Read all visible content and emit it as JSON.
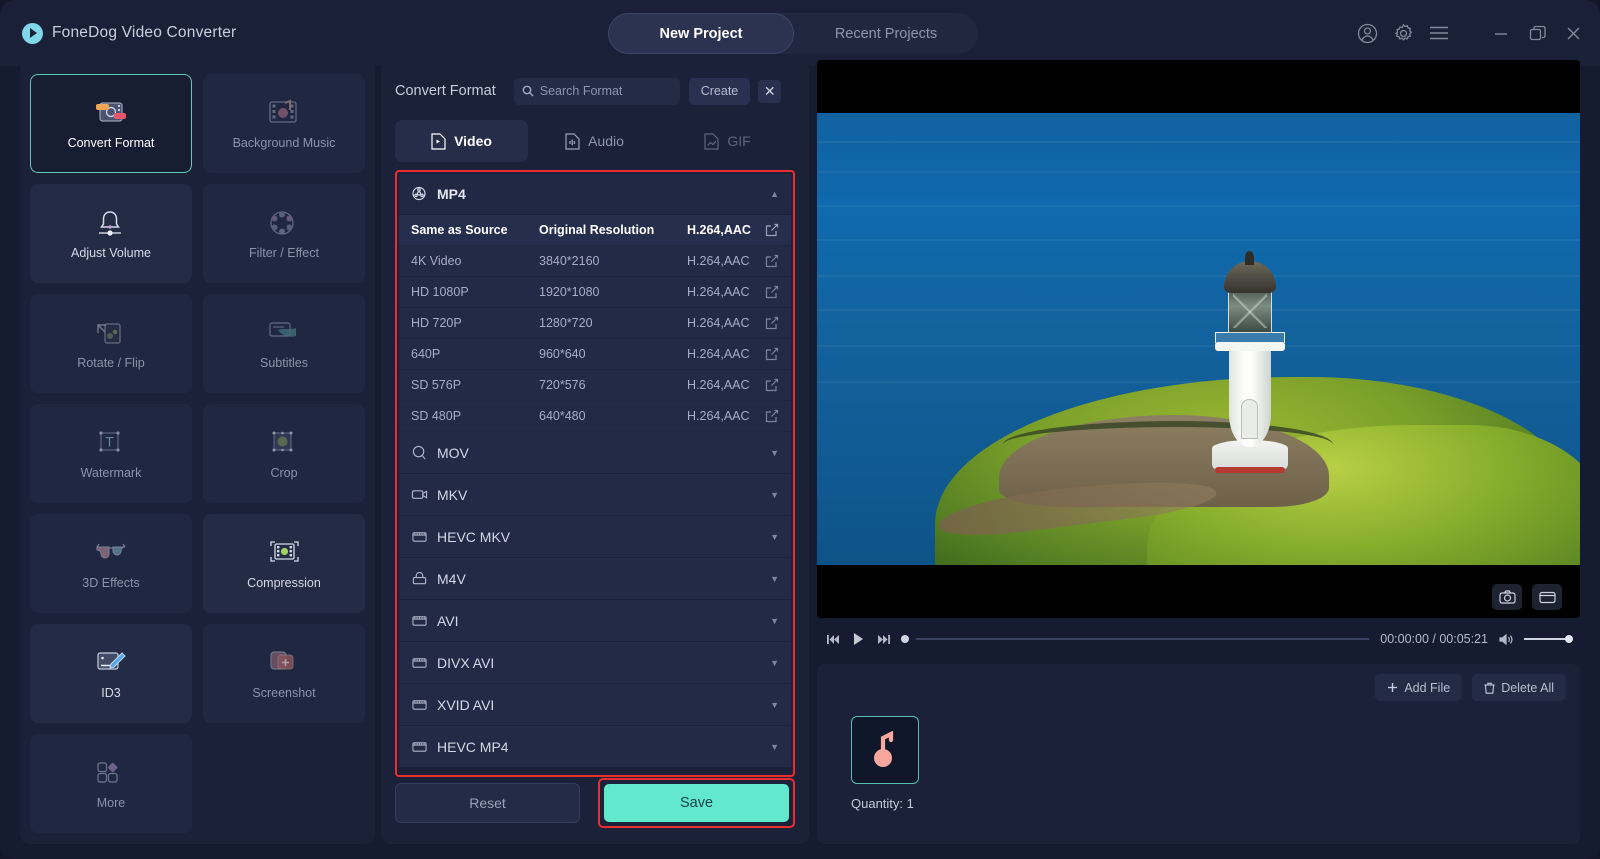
{
  "app": {
    "title": "FoneDog Video Converter",
    "logo_icon": "play-circle-icon"
  },
  "header": {
    "tabs": [
      {
        "label": "New Project",
        "active": true
      },
      {
        "label": "Recent Projects",
        "active": false
      }
    ],
    "window_icons": [
      "account-icon",
      "gear-icon",
      "menu-icon",
      "minimize-icon",
      "maximize-icon",
      "close-icon"
    ]
  },
  "sidebar": {
    "tools": [
      {
        "label": "Convert Format",
        "icon": "convert-format-icon",
        "state": "active"
      },
      {
        "label": "Background Music",
        "icon": "background-music-icon",
        "state": "dim"
      },
      {
        "label": "Adjust Volume",
        "icon": "adjust-volume-icon",
        "state": "bright"
      },
      {
        "label": "Filter / Effect",
        "icon": "filter-effect-icon",
        "state": "dim"
      },
      {
        "label": "Rotate / Flip",
        "icon": "rotate-flip-icon",
        "state": "dim"
      },
      {
        "label": "Subtitles",
        "icon": "subtitles-icon",
        "state": "dim"
      },
      {
        "label": "Watermark",
        "icon": "watermark-icon",
        "state": "dim"
      },
      {
        "label": "Crop",
        "icon": "crop-icon",
        "state": "dim"
      },
      {
        "label": "3D Effects",
        "icon": "3d-effects-icon",
        "state": "dim"
      },
      {
        "label": "Compression",
        "icon": "compression-icon",
        "state": "bright"
      },
      {
        "label": "ID3",
        "icon": "id3-icon",
        "state": "bright"
      },
      {
        "label": "Screenshot",
        "icon": "screenshot-icon",
        "state": "dim"
      },
      {
        "label": "More",
        "icon": "more-icon",
        "state": "dim"
      }
    ]
  },
  "convert_panel": {
    "title": "Convert Format",
    "search_placeholder": "Search Format",
    "search_value": "",
    "search_icon": "search-icon",
    "create_label": "Create",
    "close_label": "✕",
    "type_tabs": [
      {
        "label": "Video",
        "icon": "video-file-icon",
        "state": "active"
      },
      {
        "label": "Audio",
        "icon": "audio-file-icon",
        "state": "normal"
      },
      {
        "label": "GIF",
        "icon": "gif-file-icon",
        "state": "faded"
      }
    ],
    "expanded_group": {
      "name": "MP4",
      "icon": "film-reel-icon",
      "caret": "▲",
      "rows": [
        {
          "name": "Same as Source",
          "resolution": "Original Resolution",
          "codec": "H.264,AAC",
          "selected": true
        },
        {
          "name": "4K Video",
          "resolution": "3840*2160",
          "codec": "H.264,AAC",
          "selected": false
        },
        {
          "name": "HD 1080P",
          "resolution": "1920*1080",
          "codec": "H.264,AAC",
          "selected": false
        },
        {
          "name": "HD 720P",
          "resolution": "1280*720",
          "codec": "H.264,AAC",
          "selected": false
        },
        {
          "name": "640P",
          "resolution": "960*640",
          "codec": "H.264,AAC",
          "selected": false
        },
        {
          "name": "SD 576P",
          "resolution": "720*576",
          "codec": "H.264,AAC",
          "selected": false
        },
        {
          "name": "SD 480P",
          "resolution": "640*480",
          "codec": "H.264,AAC",
          "selected": false
        }
      ]
    },
    "collapsed_groups": [
      {
        "name": "MOV",
        "icon": "mov-icon",
        "caret": "▼"
      },
      {
        "name": "MKV",
        "icon": "mkv-icon",
        "caret": "▼"
      },
      {
        "name": "HEVC MKV",
        "icon": "hevc-icon",
        "caret": "▼"
      },
      {
        "name": "M4V",
        "icon": "m4v-icon",
        "caret": "▼"
      },
      {
        "name": "AVI",
        "icon": "avi-icon",
        "caret": "▼"
      },
      {
        "name": "DIVX AVI",
        "icon": "avi-icon",
        "caret": "▼"
      },
      {
        "name": "XVID AVI",
        "icon": "avi-icon",
        "caret": "▼"
      },
      {
        "name": "HEVC MP4",
        "icon": "hevc-icon",
        "caret": "▼"
      }
    ],
    "reset_label": "Reset",
    "save_label": "Save",
    "highlight_color": "#ec2d2d",
    "save_color": "#62e9cd"
  },
  "preview": {
    "image_description": "lighthouse on green headland above blue ocean",
    "snapshot_icons": [
      "camera-icon",
      "clip-icon"
    ],
    "player": {
      "prev_icon": "skip-back-icon",
      "play_icon": "play-icon",
      "next_icon": "skip-forward-icon",
      "time": "00:00:00 / 00:05:21",
      "volume_icon": "volume-icon"
    }
  },
  "file_panel": {
    "add_file_label": "Add File",
    "add_file_icon": "plus-icon",
    "delete_all_label": "Delete All",
    "delete_all_icon": "trash-icon",
    "thumbnail_icon": "music-note-icon",
    "quantity": "Quantity: 1"
  }
}
